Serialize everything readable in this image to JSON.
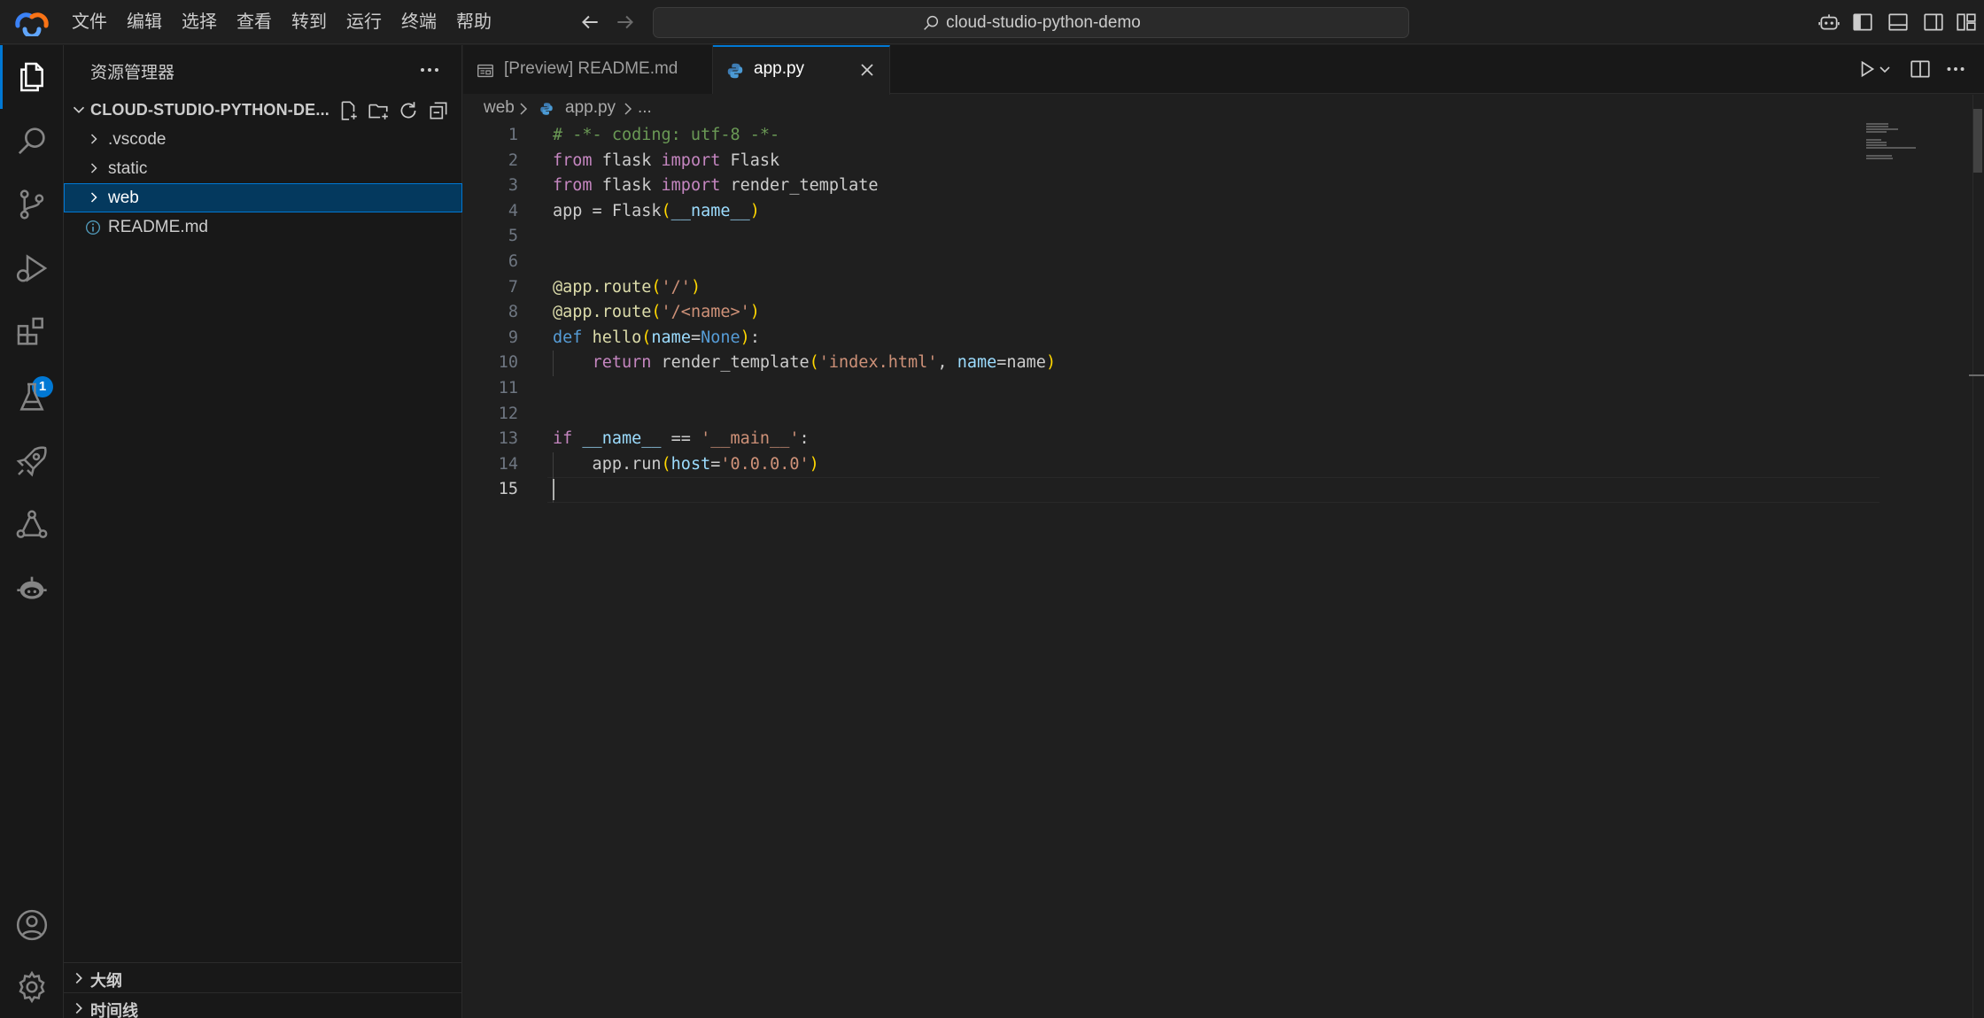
{
  "titlebar": {
    "menus": [
      "文件",
      "编辑",
      "选择",
      "查看",
      "转到",
      "运行",
      "终端",
      "帮助"
    ],
    "search_text": "cloud-studio-python-demo",
    "right_icons": [
      "copilot-icon",
      "toggle-primary-sidebar-icon",
      "toggle-panel-icon",
      "toggle-secondary-sidebar-icon",
      "customize-layout-icon"
    ]
  },
  "activitybar": {
    "items": [
      "explorer",
      "search",
      "source-control",
      "run-and-debug",
      "extensions",
      "testing",
      "deploy",
      "share",
      "codebuddy"
    ],
    "extensions_badge": "1",
    "bottom_items": [
      "accounts",
      "manage"
    ]
  },
  "sidebar": {
    "title": "资源管理器",
    "folder_name": "CLOUD-STUDIO-PYTHON-DE...",
    "tree": [
      {
        "label": ".vscode",
        "type": "folder",
        "selected": false
      },
      {
        "label": "static",
        "type": "folder",
        "selected": false
      },
      {
        "label": "web",
        "type": "folder",
        "selected": true
      },
      {
        "label": "README.md",
        "type": "file",
        "selected": false
      }
    ],
    "outline": "大纲",
    "timeline": "时间线"
  },
  "tabs": [
    {
      "label": "[Preview] README.md",
      "active": false
    },
    {
      "label": "app.py",
      "active": true
    }
  ],
  "breadcrumb": {
    "folder": "web",
    "file": "app.py",
    "symbol": "..."
  },
  "code": {
    "language": "python",
    "current_line": 15,
    "lines": [
      [
        [
          "cm",
          "# -*- coding: utf-8 -*-"
        ]
      ],
      [
        [
          "kw",
          "from"
        ],
        [
          "",
          " flask "
        ],
        [
          "kw",
          "import"
        ],
        [
          "",
          " Flask"
        ]
      ],
      [
        [
          "kw",
          "from"
        ],
        [
          "",
          " flask "
        ],
        [
          "kw",
          "import"
        ],
        [
          "",
          " render_template"
        ]
      ],
      [
        [
          "",
          "app = Flask"
        ],
        [
          "br1",
          "("
        ],
        [
          "var",
          "__name__"
        ],
        [
          "br1",
          ")"
        ]
      ],
      [],
      [],
      [
        [
          "dec",
          "@app.route"
        ],
        [
          "br1",
          "("
        ],
        [
          "str",
          "'/'"
        ],
        [
          "br1",
          ")"
        ]
      ],
      [
        [
          "dec",
          "@app.route"
        ],
        [
          "br1",
          "("
        ],
        [
          "str",
          "'/<name>'"
        ],
        [
          "br1",
          ")"
        ]
      ],
      [
        [
          "const",
          "def"
        ],
        [
          "",
          " "
        ],
        [
          "fn",
          "hello"
        ],
        [
          "br1",
          "("
        ],
        [
          "var",
          "name"
        ],
        [
          "",
          "="
        ],
        [
          "const",
          "None"
        ],
        [
          "br1",
          ")"
        ],
        [
          "",
          ":"
        ]
      ],
      [
        [
          "",
          "    "
        ],
        [
          "kw",
          "return"
        ],
        [
          "",
          " render_template"
        ],
        [
          "br1",
          "("
        ],
        [
          "str",
          "'index.html'"
        ],
        [
          "",
          ", "
        ],
        [
          "var",
          "name"
        ],
        [
          "",
          "=name"
        ],
        [
          "br1",
          ")"
        ]
      ],
      [],
      [],
      [
        [
          "kw",
          "if"
        ],
        [
          "",
          " "
        ],
        [
          "var",
          "__name__"
        ],
        [
          "",
          " == "
        ],
        [
          "str",
          "'__main__'"
        ],
        [
          "",
          ":"
        ]
      ],
      [
        [
          "",
          "    app.run"
        ],
        [
          "br1",
          "("
        ],
        [
          "var",
          "host"
        ],
        [
          "",
          "="
        ],
        [
          "str",
          "'0.0.0.0'"
        ],
        [
          "br1",
          ")"
        ]
      ],
      []
    ]
  },
  "colors": {
    "accent": "#0078d4",
    "editor_bg": "#1f1f1f",
    "sidebar_bg": "#181818"
  }
}
